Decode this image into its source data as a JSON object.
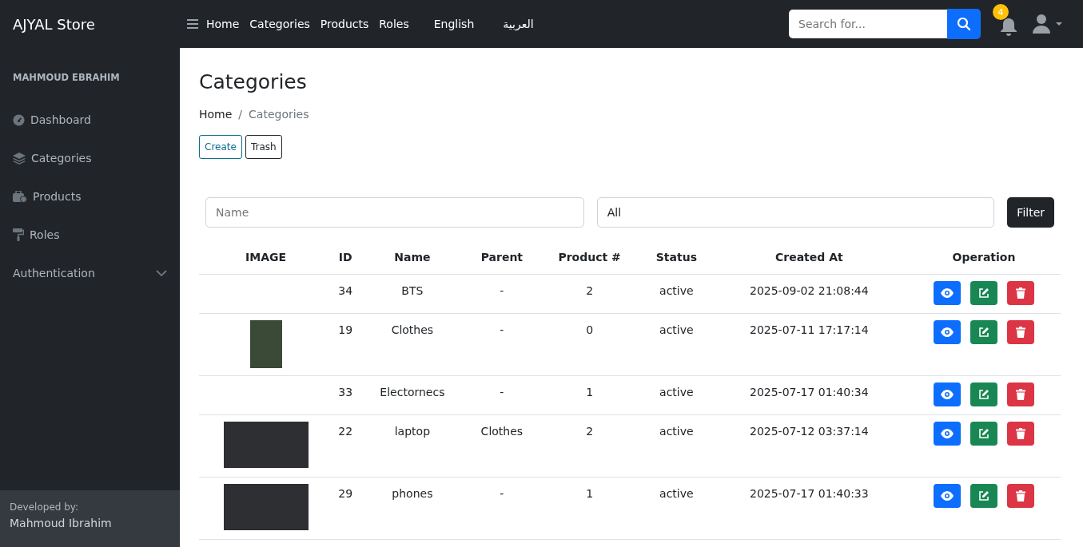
{
  "brand": "AJYAL Store",
  "nav": {
    "links": [
      "Home",
      "Categories",
      "Products",
      "Roles"
    ],
    "languages": [
      "English",
      "العربية"
    ]
  },
  "search": {
    "placeholder": "Search for..."
  },
  "notifications": {
    "count": "4"
  },
  "sidebar": {
    "user": "MAHMOUD EBRAHIM",
    "items": [
      {
        "label": "Dashboard",
        "kind": "dashboard"
      },
      {
        "label": "Categories",
        "kind": "layers"
      },
      {
        "label": "Products",
        "kind": "toolbox"
      },
      {
        "label": "Roles",
        "kind": "roller"
      },
      {
        "label": "Authentication",
        "kind": "dropdown"
      }
    ],
    "footer": {
      "caption": "Developed by:",
      "name": "Mahmoud Ibrahim"
    }
  },
  "page": {
    "title": "Categories",
    "breadcrumb": [
      "Home",
      "Categories"
    ],
    "breadcrumb_separator": "/",
    "actions": [
      "Create",
      "Trash"
    ]
  },
  "filter": {
    "name_placeholder": "Name",
    "status_value": "All",
    "button": "Filter"
  },
  "table": {
    "columns": [
      "IMAGE",
      "ID",
      "Name",
      "Parent",
      "Product #",
      "Status",
      "Created At",
      "Operation"
    ],
    "rows": [
      {
        "kind": "no-image",
        "id": "34",
        "name": "BTS",
        "parent": "-",
        "products": "2",
        "status": "active",
        "created": "2025-09-02 21:08:44"
      },
      {
        "kind": "portrait-photo",
        "id": "19",
        "name": "Clothes",
        "parent": "-",
        "products": "0",
        "status": "active",
        "created": "2025-07-11 17:17:14"
      },
      {
        "kind": "no-image",
        "id": "33",
        "name": "Electornecs",
        "parent": "-",
        "products": "1",
        "status": "active",
        "created": "2025-07-17 01:40:34"
      },
      {
        "kind": "landscape-photo",
        "id": "22",
        "name": "laptop",
        "parent": "Clothes",
        "products": "2",
        "status": "active",
        "created": "2025-07-12 03:37:14"
      },
      {
        "kind": "landscape-photo",
        "id": "29",
        "name": "phones",
        "parent": "-",
        "products": "1",
        "status": "active",
        "created": "2025-07-17 01:40:33"
      }
    ]
  }
}
